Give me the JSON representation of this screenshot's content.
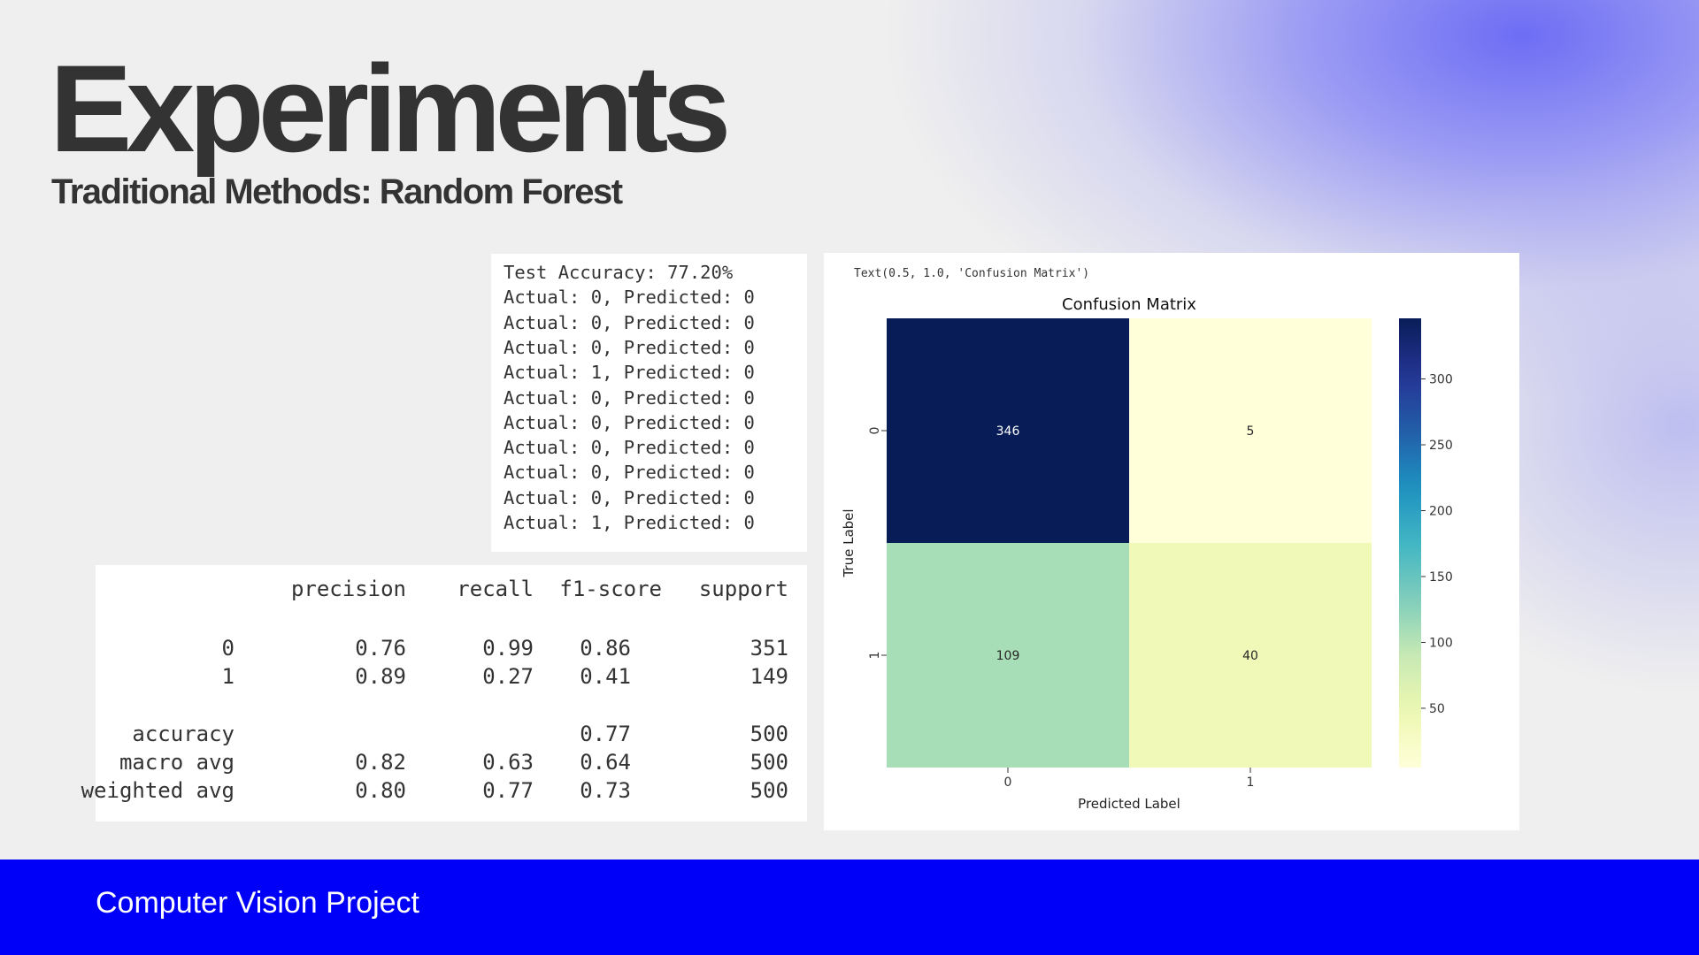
{
  "slide": {
    "title": "Experiments",
    "subtitle": "Traditional Methods: Random Forest",
    "footer": "Computer Vision Project"
  },
  "colors": {
    "background": "#efefef",
    "footer": "#0000f8",
    "text": "#333333",
    "glow": "#6b6bf5"
  },
  "output": {
    "lines": [
      "Test Accuracy: 77.20%",
      "Actual: 0, Predicted: 0",
      "Actual: 0, Predicted: 0",
      "Actual: 0, Predicted: 0",
      "Actual: 1, Predicted: 0",
      "Actual: 0, Predicted: 0",
      "Actual: 0, Predicted: 0",
      "Actual: 0, Predicted: 0",
      "Actual: 0, Predicted: 0",
      "Actual: 0, Predicted: 0",
      "Actual: 1, Predicted: 0"
    ]
  },
  "report": {
    "headers": [
      "precision",
      "recall",
      "f1-score",
      "support"
    ],
    "rows": [
      [
        "0",
        "0.76",
        "0.99",
        "0.86",
        "351"
      ],
      [
        "1",
        "0.89",
        "0.27",
        "0.41",
        "149"
      ],
      [
        "accuracy",
        "",
        "",
        "0.77",
        "500"
      ],
      [
        "macro avg",
        "0.82",
        "0.63",
        "0.64",
        "500"
      ],
      [
        "weighted avg",
        "0.80",
        "0.77",
        "0.73",
        "500"
      ]
    ]
  },
  "chart_data": {
    "type": "heatmap",
    "output_text": "Text(0.5, 1.0, 'Confusion Matrix')",
    "title": "Confusion Matrix",
    "xlabel": "Predicted Label",
    "ylabel": "True Label",
    "x_categories": [
      "0",
      "1"
    ],
    "y_categories": [
      "0",
      "1"
    ],
    "values": [
      [
        346,
        5
      ],
      [
        109,
        40
      ]
    ],
    "colormap": "YlGnBu",
    "colorbar_range": [
      5,
      346
    ],
    "colorbar_ticks": [
      50,
      100,
      150,
      200,
      250,
      300
    ]
  }
}
